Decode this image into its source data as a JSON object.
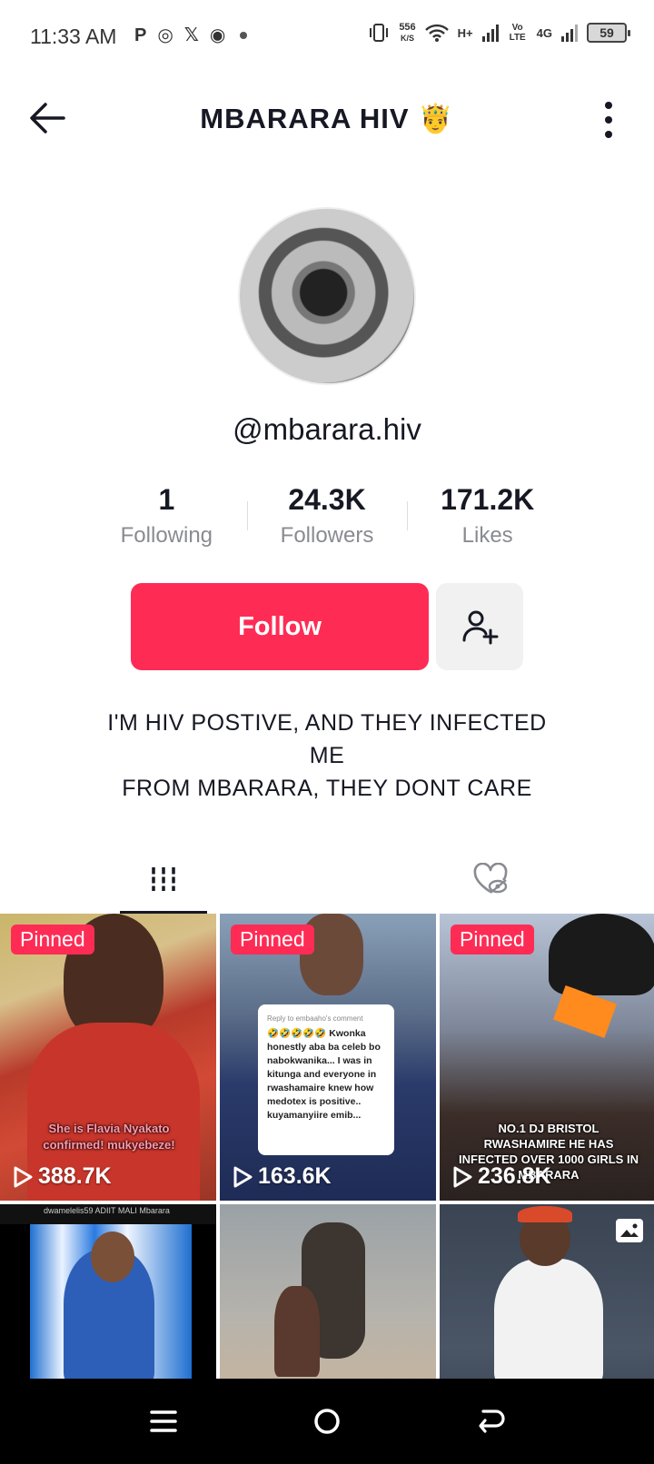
{
  "status_bar": {
    "time": "11:33 AM",
    "net_speed_value": "556",
    "net_speed_unit": "K/S",
    "network_labels": [
      "H+",
      "Vo LTE",
      "4G"
    ],
    "battery": "59"
  },
  "header": {
    "title": "MBARARA HIV 🤴"
  },
  "profile": {
    "username": "@mbarara.hiv",
    "stats": [
      {
        "value": "1",
        "label": "Following"
      },
      {
        "value": "24.3K",
        "label": "Followers"
      },
      {
        "value": "171.2K",
        "label": "Likes"
      }
    ],
    "follow_label": "Follow",
    "bio_lines": [
      "I'M HIV POSTIVE, AND THEY INFECTED",
      "ME",
      "FROM MBARARA, THEY DONT CARE"
    ]
  },
  "tabs": {
    "videos_icon": "grid-icon",
    "liked_icon": "hidden-heart-icon"
  },
  "videos": [
    {
      "pinned": "Pinned",
      "views": "388.7K",
      "overlay": "She is Flavia Nyakato confirmed! mukyebeze!"
    },
    {
      "pinned": "Pinned",
      "views": "163.6K",
      "comment_header": "Reply to embaaho's comment",
      "comment_text": "🤣🤣🤣🤣🤣 Kwonka honestly aba ba celeb bo nabokwanika... I was in kitunga and everyone in rwashamaire knew how medotex is positive.. kuyamanyiire emib..."
    },
    {
      "pinned": "Pinned",
      "views": "236.8K",
      "overlay": "NO.1 DJ BRISTOL RWASHAMIRE HE HAS INFECTED OVER 1000 GIRLS IN MBARARA"
    },
    {
      "caption": "dwamelelis59 ADIIT MALI Mbarara"
    },
    {},
    {
      "icon": "photo-icon"
    }
  ],
  "colors": {
    "accent": "#fe2c55",
    "text": "#161823",
    "muted": "#8a8b91"
  }
}
